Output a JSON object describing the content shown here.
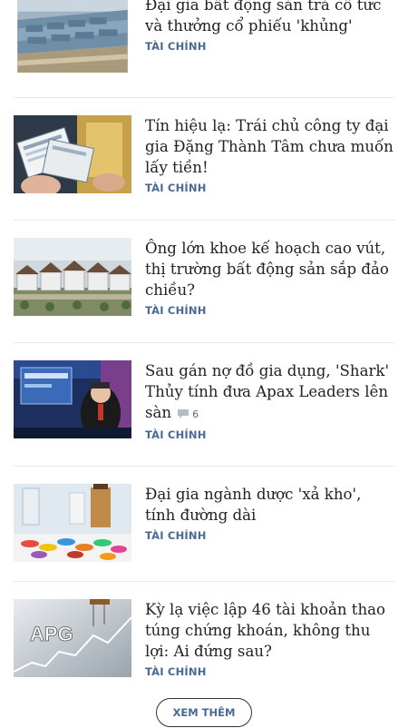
{
  "articles": [
    {
      "title": "Đại gia bất động sản trả cổ tức và thưởng cổ phiếu 'khủng'",
      "category": "TÀI CHÍNH",
      "image": "industrial-park-aerial"
    },
    {
      "title": "Tín hiệu lạ: Trái chủ công ty đại gia Đặng Thành Tâm chưa muốn lấy tiền!",
      "category": "TÀI CHÍNH",
      "image": "bond-certificates-hands"
    },
    {
      "title": "Ông lớn khoe kế hoạch cao vút, thị trường bất động sản sắp đảo chiều?",
      "category": "TÀI CHÍNH",
      "image": "housing-villas"
    },
    {
      "title": "Sau gán nợ đồ gia dụng, 'Shark' Thủy tính đưa Apax Leaders lên sàn",
      "category": "TÀI CHÍNH",
      "comment_count": "6",
      "image": "tv-studio-man"
    },
    {
      "title": "Đại gia ngành dược 'xả kho', tính đường dài",
      "category": "TÀI CHÍNH",
      "image": "medicine-pills"
    },
    {
      "title": "Kỳ lạ việc lập 46 tài khoản thao túng chứng khoán, không thu lợi: Ai đứng sau?",
      "category": "TÀI CHÍNH",
      "image": "apg-puppet-chart",
      "image_text": "APG"
    }
  ],
  "load_more_label": "XEM THÊM",
  "colors": {
    "category": "#4a6a96",
    "title": "#222222",
    "divider": "#e8e8e8"
  }
}
